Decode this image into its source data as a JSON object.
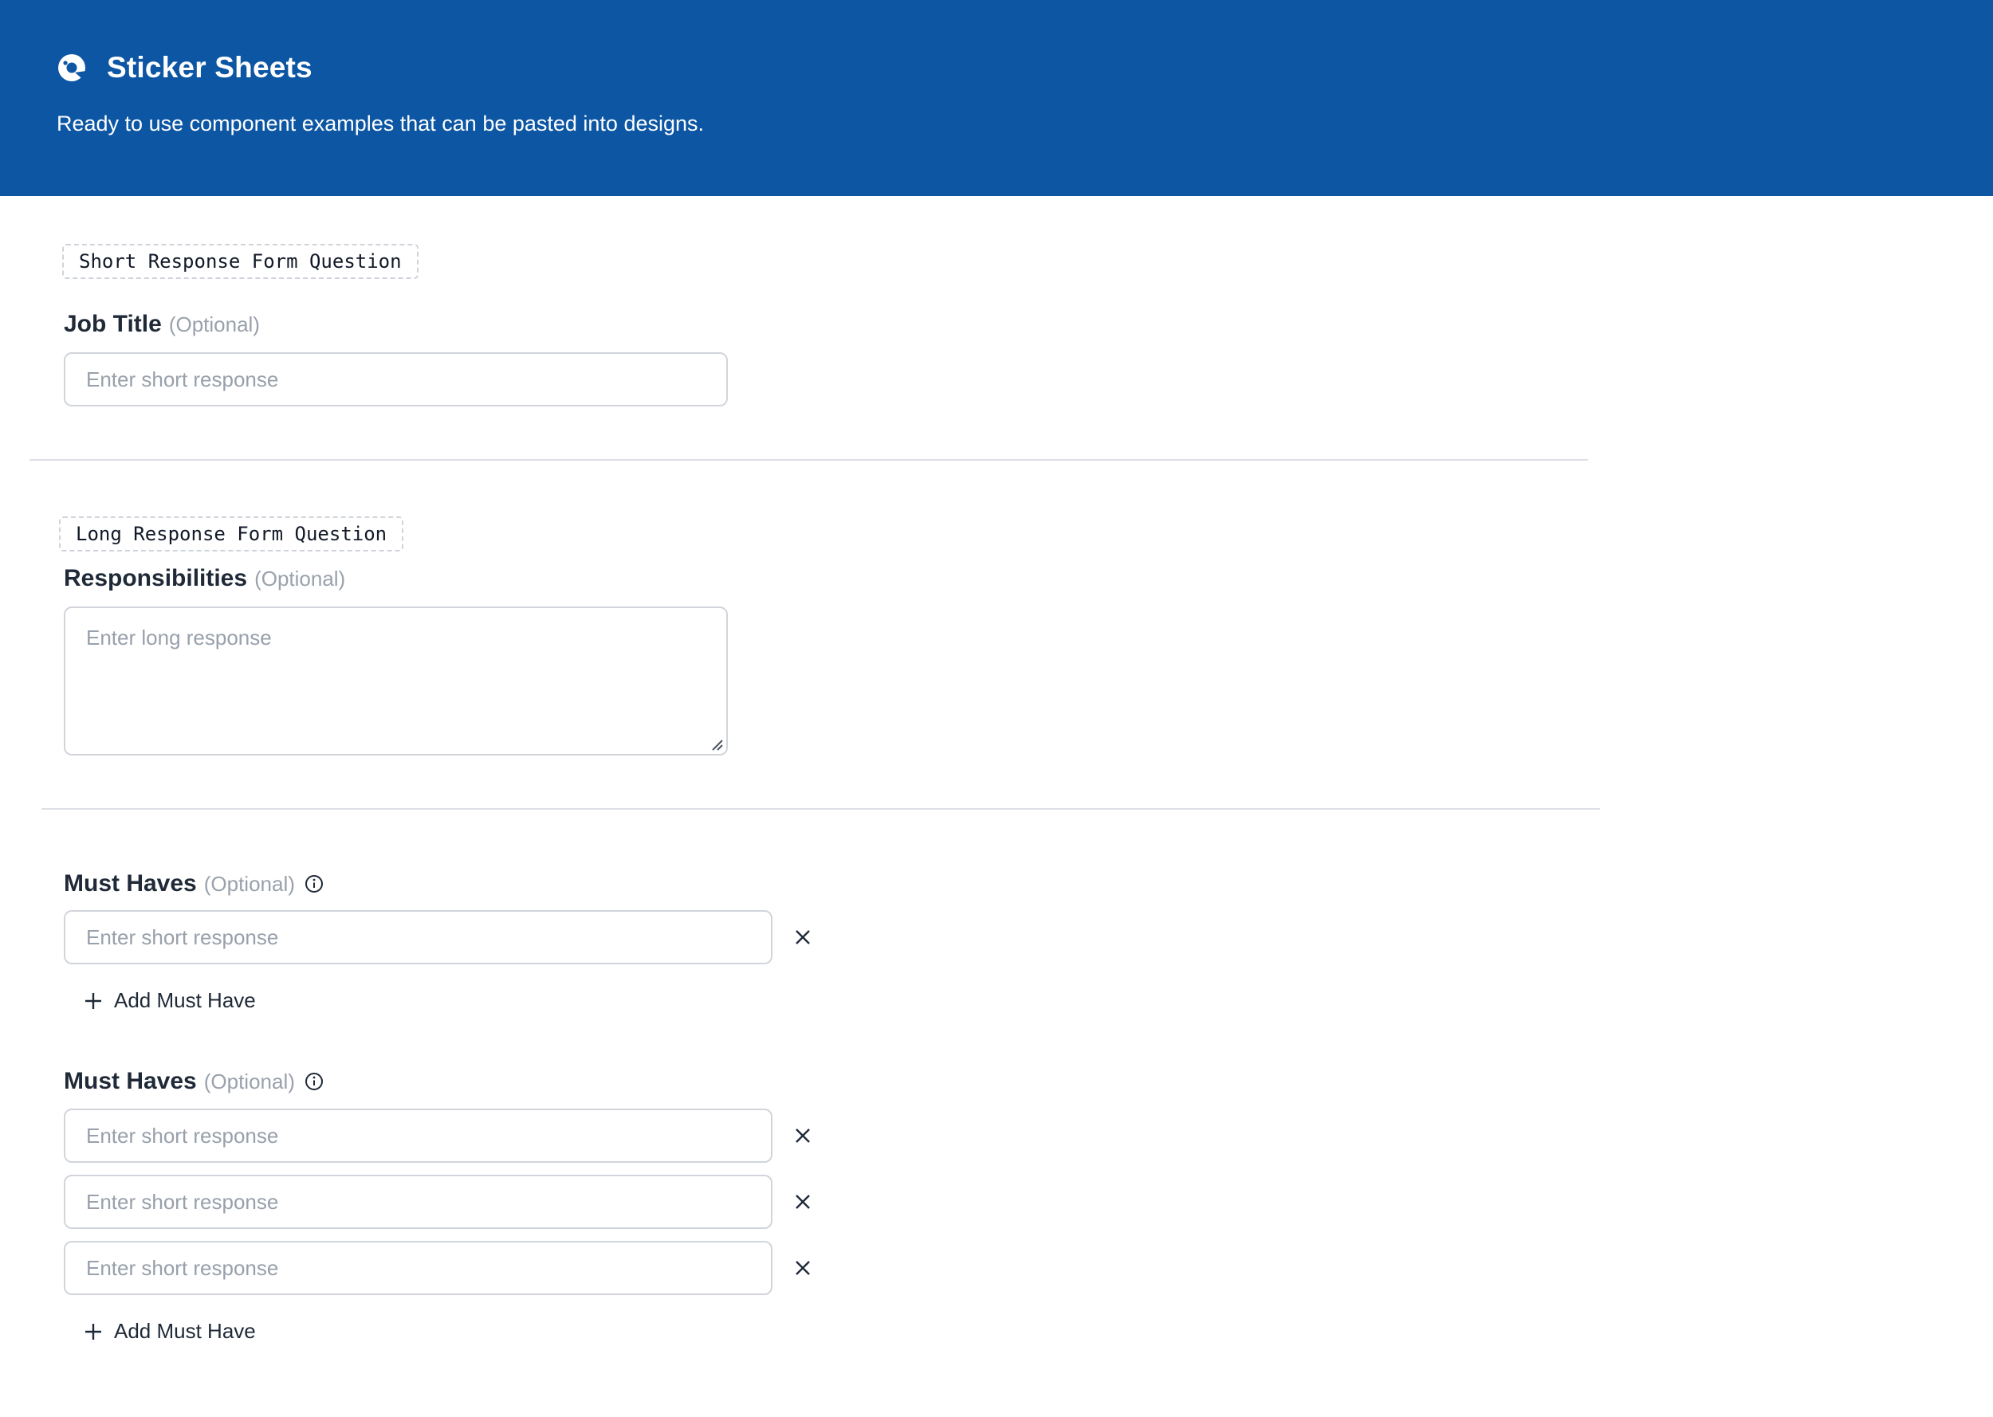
{
  "header": {
    "title": "Sticker Sheets",
    "subtitle": "Ready to use component examples that can be pasted into designs.",
    "logo_icon": "palette-icon",
    "background": "#0c56a3"
  },
  "short_response_section": {
    "tag": "Short Response Form Question",
    "label": "Job Title",
    "optional": "(Optional)",
    "input": {
      "value": "",
      "placeholder": "Enter short response"
    }
  },
  "long_response_section": {
    "tag": "Long Response Form Question",
    "label": "Responsibilities",
    "optional": "(Optional)",
    "textarea": {
      "value": "",
      "placeholder": "Enter long response"
    }
  },
  "must_haves_single": {
    "label": "Must Haves",
    "optional": "(Optional)",
    "info_icon": "info-icon",
    "items": [
      {
        "value": "",
        "placeholder": "Enter short response",
        "remove_icon": "close-icon"
      }
    ],
    "add_label": "Add Must Have"
  },
  "must_haves_multi": {
    "label": "Must Haves",
    "optional": "(Optional)",
    "info_icon": "info-icon",
    "items": [
      {
        "value": "",
        "placeholder": "Enter short response",
        "remove_icon": "close-icon"
      },
      {
        "value": "",
        "placeholder": "Enter short response",
        "remove_icon": "close-icon"
      },
      {
        "value": "",
        "placeholder": "Enter short response",
        "remove_icon": "close-icon"
      }
    ],
    "add_label": "Add Must Have"
  }
}
